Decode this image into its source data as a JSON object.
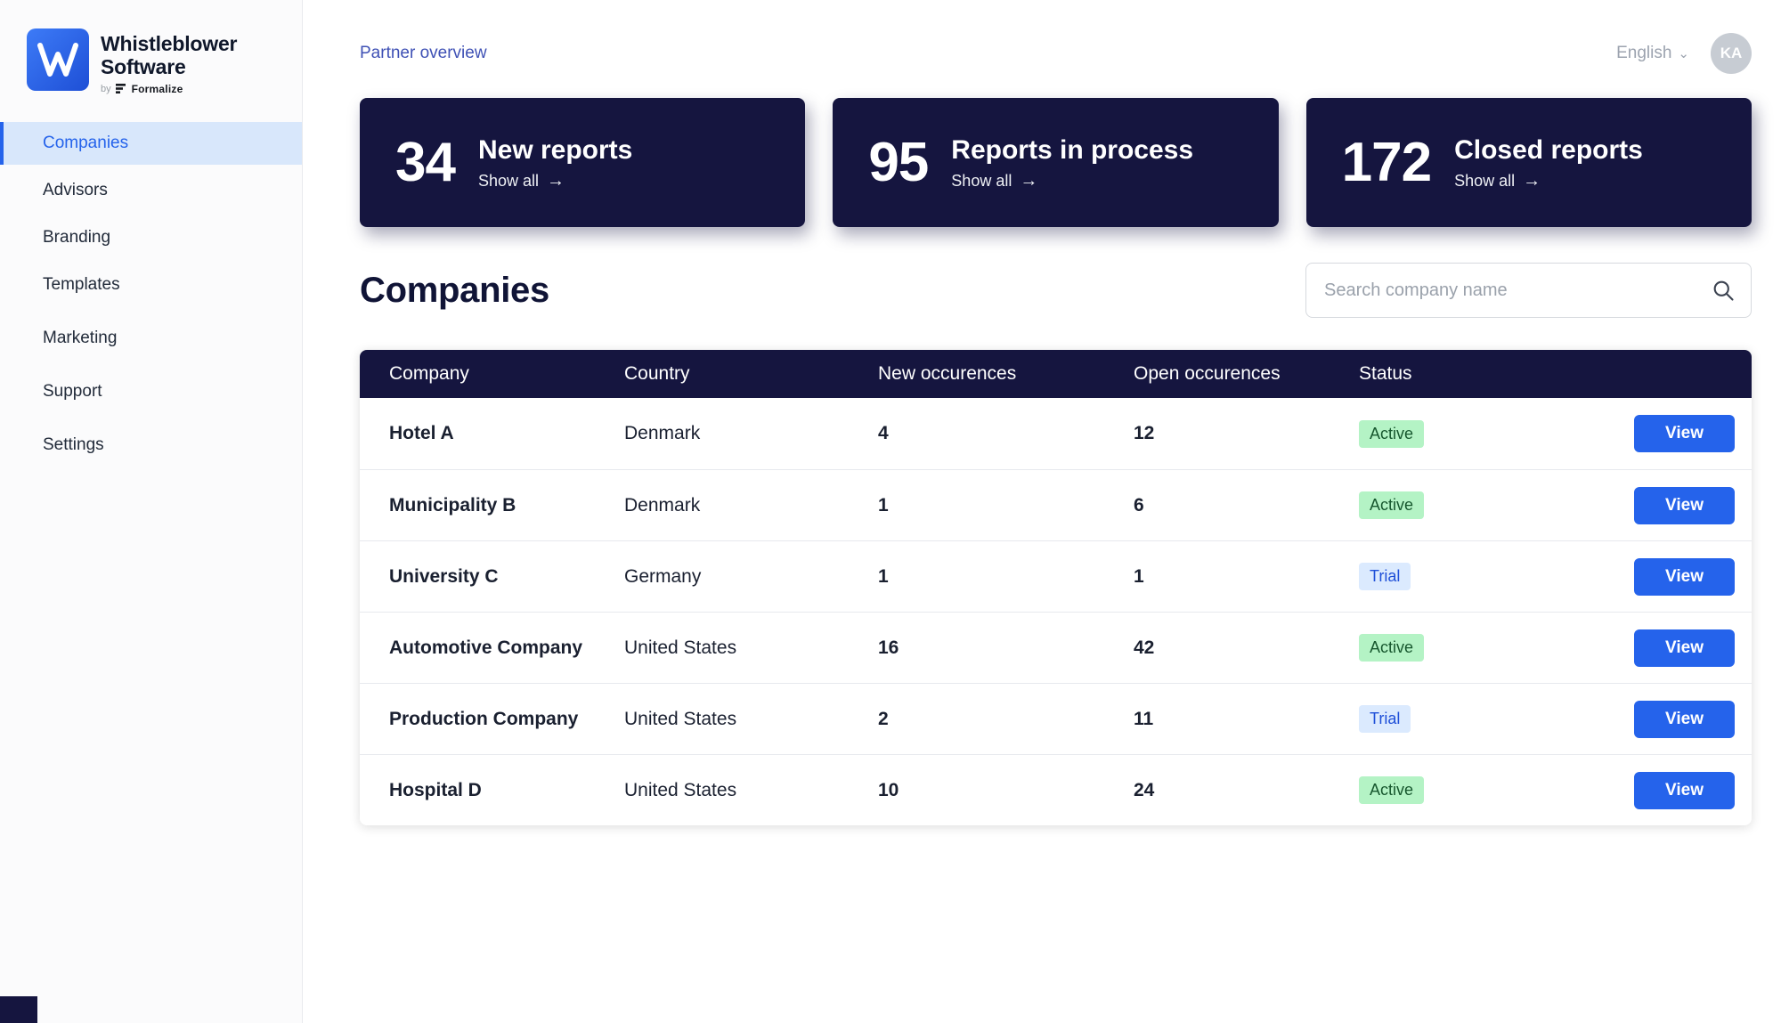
{
  "sidebar": {
    "logo": {
      "line1": "Whistleblower",
      "line2": "Software",
      "byline_prefix": "by",
      "byline_brand": "Formalize"
    },
    "items": [
      {
        "label": "Companies",
        "active": true
      },
      {
        "label": "Advisors",
        "active": false
      },
      {
        "label": "Branding",
        "active": false
      },
      {
        "label": "Templates",
        "active": false
      },
      {
        "label": "Marketing",
        "active": false
      },
      {
        "label": "Support",
        "active": false
      },
      {
        "label": "Settings",
        "active": false
      }
    ]
  },
  "header": {
    "breadcrumb": "Partner overview",
    "language": "English",
    "avatar_initials": "KA"
  },
  "stats": [
    {
      "value": "34",
      "label": "New reports",
      "link_label": "Show all"
    },
    {
      "value": "95",
      "label": "Reports in process",
      "link_label": "Show all"
    },
    {
      "value": "172",
      "label": "Closed reports",
      "link_label": "Show all"
    }
  ],
  "companies": {
    "title": "Companies",
    "search_placeholder": "Search company name",
    "table": {
      "headers": [
        "Company",
        "Country",
        "New occurences",
        "Open occurences",
        "Status",
        ""
      ],
      "view_label": "View",
      "rows": [
        {
          "company": "Hotel A",
          "country": "Denmark",
          "new_occurrences": "4",
          "open_occurrences": "12",
          "status": "Active",
          "status_type": "active"
        },
        {
          "company": "Municipality B",
          "country": "Denmark",
          "new_occurrences": "1",
          "open_occurrences": "6",
          "status": "Active",
          "status_type": "active"
        },
        {
          "company": "University C",
          "country": "Germany",
          "new_occurrences": "1",
          "open_occurrences": "1",
          "status": "Trial",
          "status_type": "trial"
        },
        {
          "company": "Automotive Company",
          "country": "United States",
          "new_occurrences": "16",
          "open_occurrences": "42",
          "status": "Active",
          "status_type": "active"
        },
        {
          "company": "Production Company",
          "country": "United States",
          "new_occurrences": "2",
          "open_occurrences": "11",
          "status": "Trial",
          "status_type": "trial"
        },
        {
          "company": "Hospital D",
          "country": "United States",
          "new_occurrences": "10",
          "open_occurrences": "24",
          "status": "Active",
          "status_type": "active"
        }
      ]
    }
  },
  "icons": {
    "arrow_right": "→",
    "chevron_down": "⌄"
  },
  "colors": {
    "navy": "#15153f",
    "primary_blue": "#2563eb",
    "sidebar_active_bg": "#d8e7fb",
    "breadcrumb_blue": "#3f51b5",
    "active_badge_bg": "#b4f3c5",
    "active_badge_text": "#17572e",
    "trial_badge_bg": "#dbeafe",
    "trial_badge_text": "#1e4fd8"
  }
}
